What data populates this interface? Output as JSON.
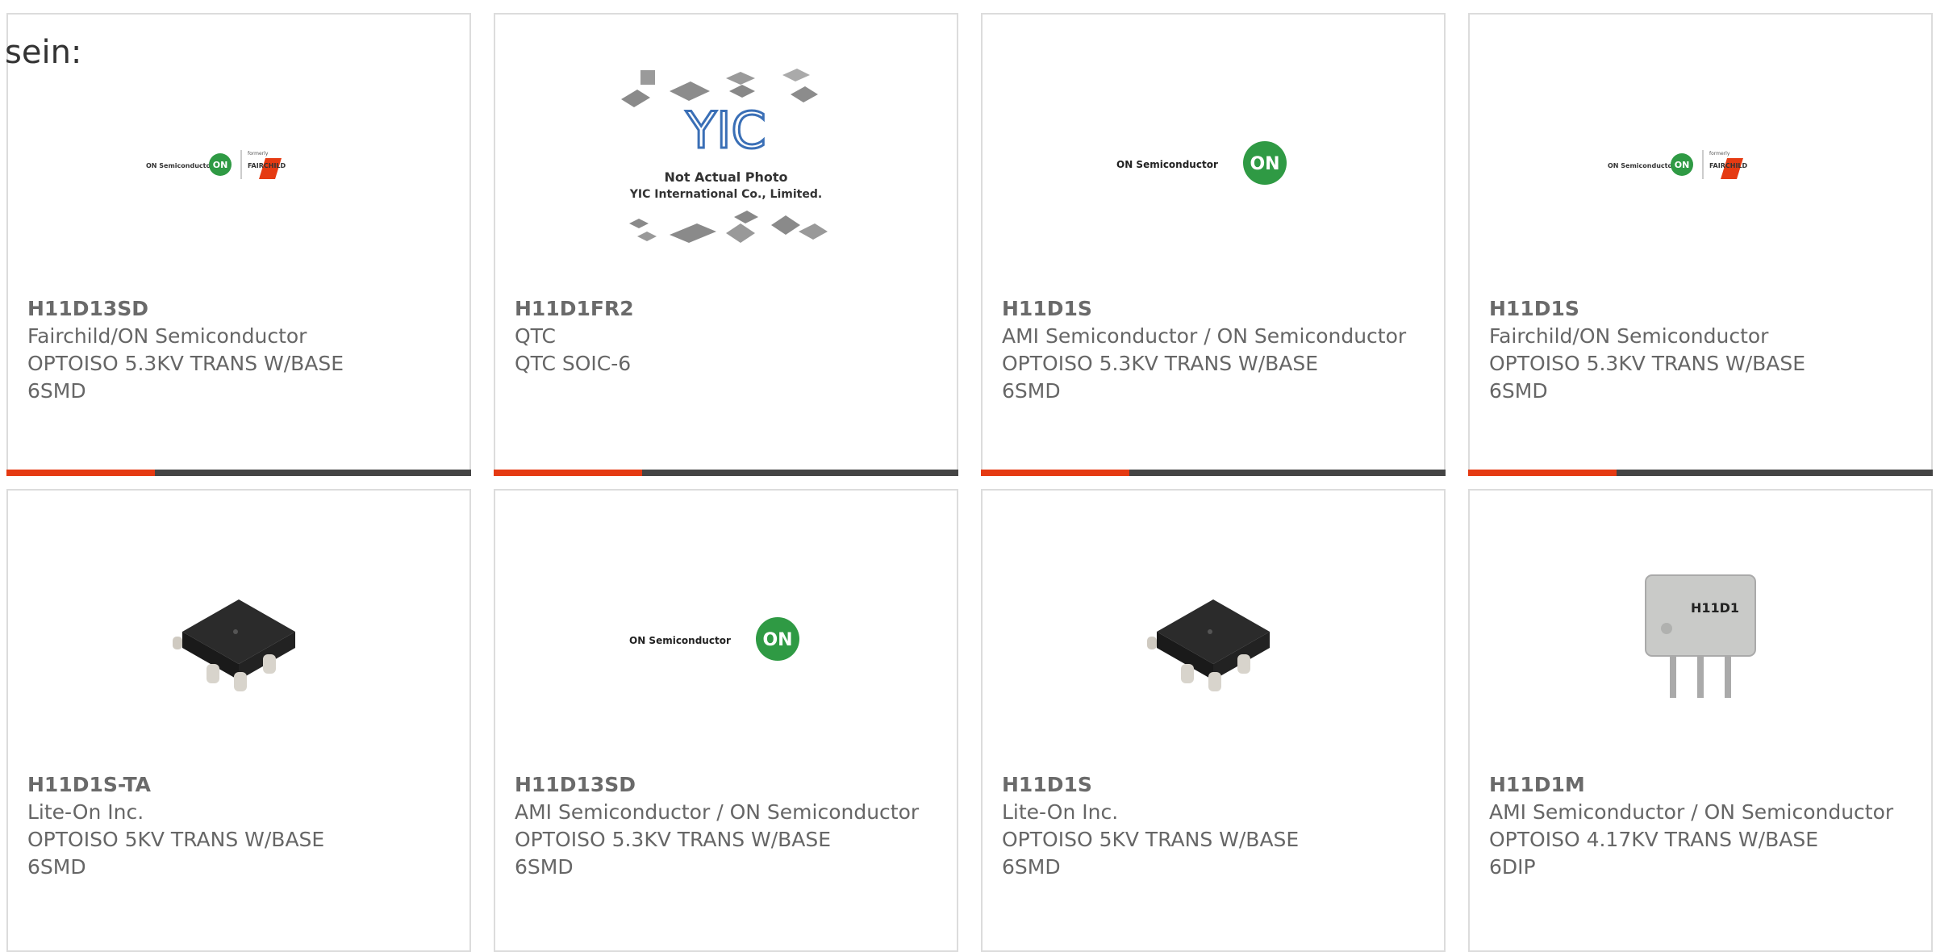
{
  "lead_text": "sein:",
  "products": [
    {
      "part": "H11D13SD",
      "maker": "Fairchild/ON Semiconductor",
      "desc": "OPTOISO 5.3KV TRANS W/BASE",
      "pkg": "6SMD",
      "image": "on-fairchild-logo",
      "logo_text": "ON Semiconductor",
      "logo_text2": "FAIRCHILD",
      "logo_text3": "formerly"
    },
    {
      "part": "H11D1FR2",
      "maker": "QTC",
      "desc": "QTC SOIC-6",
      "pkg": "",
      "image": "yic-placeholder",
      "logo_text": "YIC",
      "logo_text2": "Not Actual Photo",
      "logo_text3": "YIC International Co., Limited."
    },
    {
      "part": "H11D1S",
      "maker": "AMI Semiconductor / ON Semiconductor",
      "desc": "OPTOISO 5.3KV TRANS W/BASE",
      "pkg": "6SMD",
      "image": "on-logo",
      "logo_text": "ON Semiconductor",
      "logo_text2": "ON",
      "logo_text3": ""
    },
    {
      "part": "H11D1S",
      "maker": "Fairchild/ON Semiconductor",
      "desc": "OPTOISO 5.3KV TRANS W/BASE",
      "pkg": "6SMD",
      "image": "on-fairchild-logo",
      "logo_text": "ON Semiconductor",
      "logo_text2": "FAIRCHILD",
      "logo_text3": "formerly"
    },
    {
      "part": "H11D1S-TA",
      "maker": "Lite-On Inc.",
      "desc": "OPTOISO 5KV TRANS W/BASE",
      "pkg": "6SMD",
      "image": "smd-chip-photo",
      "logo_text": "",
      "logo_text2": "",
      "logo_text3": ""
    },
    {
      "part": "H11D13SD",
      "maker": "AMI Semiconductor / ON Semiconductor",
      "desc": "OPTOISO 5.3KV TRANS W/BASE",
      "pkg": "6SMD",
      "image": "on-logo",
      "logo_text": "ON Semiconductor",
      "logo_text2": "ON",
      "logo_text3": ""
    },
    {
      "part": "H11D1S",
      "maker": "Lite-On Inc.",
      "desc": "OPTOISO 5KV TRANS W/BASE",
      "pkg": "6SMD",
      "image": "smd-chip-photo",
      "logo_text": "",
      "logo_text2": "",
      "logo_text3": ""
    },
    {
      "part": "H11D1M",
      "maker": "AMI Semiconductor / ON Semiconductor",
      "desc": "OPTOISO 4.17KV TRANS W/BASE",
      "pkg": "6DIP",
      "image": "dip-chip-photo",
      "logo_text": "H11D1",
      "logo_text2": "",
      "logo_text3": ""
    }
  ],
  "colors": {
    "accent": "#e53a12",
    "bar": "#444444",
    "on_green": "#2f9a44",
    "border": "#dcdcdc"
  }
}
